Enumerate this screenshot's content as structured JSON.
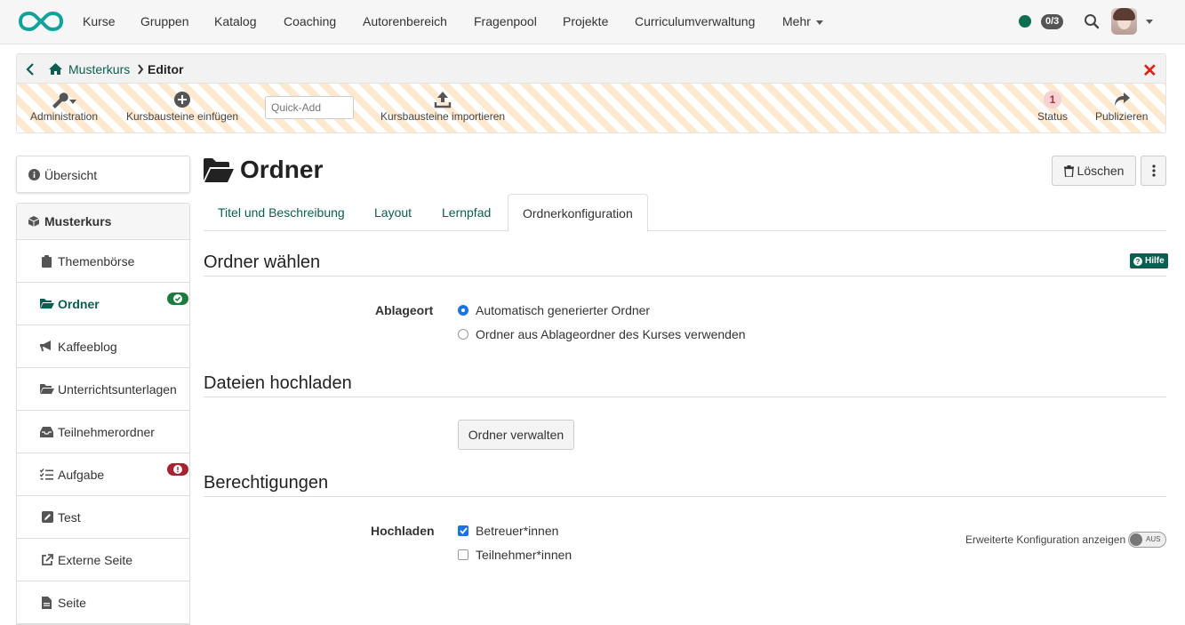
{
  "topnav": {
    "items": [
      "Kurse",
      "Gruppen",
      "Katalog",
      "Coaching",
      "Autorenbereich",
      "Fragenpool",
      "Projekte",
      "Curriculumverwaltung",
      "Mehr"
    ],
    "counter": "0/3"
  },
  "editor": {
    "breadcrumb": {
      "course": "Musterkurs",
      "current": "Editor"
    },
    "tools": {
      "administration": "Administration",
      "insert": "Kursbausteine einfügen",
      "quickadd_placeholder": "Quick-Add",
      "import": "Kursbausteine importieren",
      "status": "Status",
      "status_count": "1",
      "publish": "Publizieren"
    }
  },
  "sidebar": {
    "overview": "Übersicht",
    "root": "Musterkurs",
    "items": [
      {
        "label": "Themenbörse",
        "icon": "clipboard-icon"
      },
      {
        "label": "Ordner",
        "icon": "folder-open-icon",
        "active": true,
        "status": "ok"
      },
      {
        "label": "Kaffeeblog",
        "icon": "bullhorn-icon"
      },
      {
        "label": "Unterrichtsunterlagen",
        "icon": "folder-open-icon"
      },
      {
        "label": "Teilnehmerordner",
        "icon": "inbox-icon"
      },
      {
        "label": "Aufgabe",
        "icon": "tasks-icon",
        "status": "error"
      },
      {
        "label": "Test",
        "icon": "edit-icon"
      },
      {
        "label": "Externe Seite",
        "icon": "external-link-icon"
      },
      {
        "label": "Seite",
        "icon": "file-icon"
      }
    ]
  },
  "main": {
    "title": "Ordner",
    "delete_label": "Löschen",
    "tabs": [
      "Titel und Beschreibung",
      "Layout",
      "Lernpfad",
      "Ordnerkonfiguration"
    ],
    "active_tab": "Ordnerkonfiguration",
    "help_label": "Hilfe",
    "section1": {
      "title": "Ordner wählen",
      "field_label": "Ablageort",
      "options": [
        "Automatisch generierter Ordner",
        "Ordner aus Ablageordner des Kurses verwenden"
      ],
      "selected": 0
    },
    "section2": {
      "title": "Dateien hochladen",
      "button": "Ordner verwalten"
    },
    "section3": {
      "title": "Berechtigungen",
      "field_label": "Hochladen",
      "checkboxes": [
        {
          "label": "Betreuer*innen",
          "checked": true
        },
        {
          "label": "Teilnehmer*innen",
          "checked": false
        }
      ],
      "advanced_label": "Erweiterte Konfiguration anzeigen",
      "toggle_label": "AUS"
    }
  },
  "colors": {
    "brand": "#0b5e52",
    "accent": "#1a73e8",
    "close": "#d9261c"
  }
}
